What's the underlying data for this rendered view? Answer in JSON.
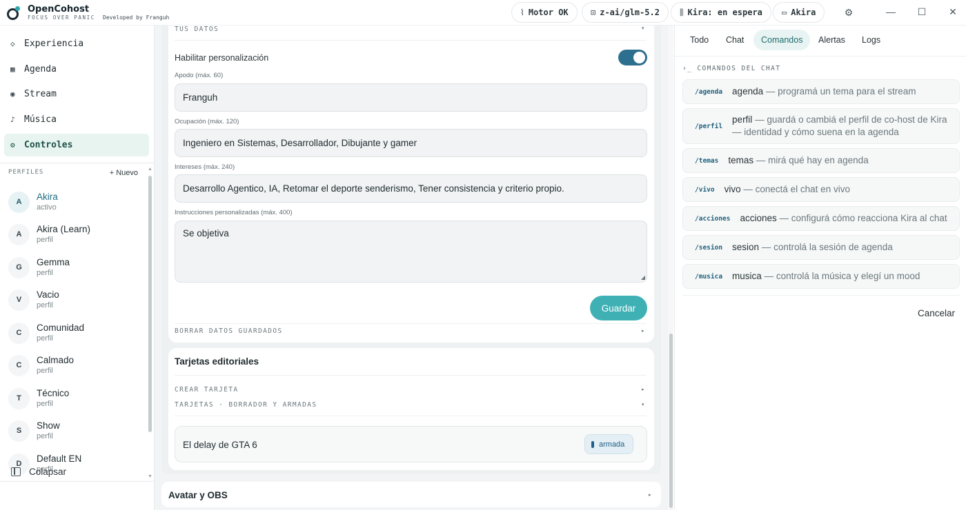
{
  "app": {
    "title": "OpenCohost",
    "tagline": "FOCUS OVER PANIC",
    "developed_by": "Developed by Franguh"
  },
  "topbar": {
    "motor": "Motor OK",
    "model": "z-ai/glm-5.2",
    "kira_status": "Kira: en espera",
    "profile": "Akira"
  },
  "sidebar": {
    "nav": [
      {
        "label": "Experiencia",
        "icon": "diamond-icon"
      },
      {
        "label": "Agenda",
        "icon": "square-icon"
      },
      {
        "label": "Stream",
        "icon": "record-icon"
      },
      {
        "label": "Música",
        "icon": "music-note-icon"
      },
      {
        "label": "Controles",
        "icon": "gear-icon"
      }
    ],
    "profiles_header": "PERFILES",
    "new_label": "+ Nuevo",
    "profiles": [
      {
        "initial": "A",
        "name": "Akira",
        "status": "activo"
      },
      {
        "initial": "A",
        "name": "Akira (Learn)",
        "status": "perfil"
      },
      {
        "initial": "G",
        "name": "Gemma",
        "status": "perfil"
      },
      {
        "initial": "V",
        "name": "Vacio",
        "status": "perfil"
      },
      {
        "initial": "C",
        "name": "Comunidad",
        "status": "perfil"
      },
      {
        "initial": "C",
        "name": "Calmado",
        "status": "perfil"
      },
      {
        "initial": "T",
        "name": "Técnico",
        "status": "perfil"
      },
      {
        "initial": "S",
        "name": "Show",
        "status": "perfil"
      },
      {
        "initial": "D",
        "name": "Default EN",
        "status": "perfil"
      }
    ],
    "collapse_label": "Colapsar"
  },
  "main": {
    "tus_datos": "TUS DATOS",
    "personalize_label": "Habilitar personalización",
    "personalize_enabled": true,
    "apodo_label": "Apodo (máx. 60)",
    "apodo_value": "Franguh",
    "ocupacion_label": "Ocupación (máx. 120)",
    "ocupacion_value": "Ingeniero en Sistemas, Desarrollador, Dibujante y gamer",
    "intereses_label": "Intereses (máx. 240)",
    "intereses_value": "Desarrollo Agentico, IA, Retomar el deporte senderismo, Tener consistencia y criterio propio.",
    "instrucciones_label": "Instrucciones personalizadas (máx. 400)",
    "instrucciones_value": "Se objetiva",
    "save_label": "Guardar",
    "borrar_label": "BORRAR DATOS GUARDADOS",
    "tarjetas_title": "Tarjetas editoriales",
    "crear_label": "CREAR TARJETA",
    "tarjetas_list_label": "TARJETAS · BORRADOR Y ARMADAS",
    "tarjeta_name": "El delay de GTA 6",
    "tarjeta_badge": "armada",
    "avatar_obs_title": "Avatar y OBS"
  },
  "right": {
    "tabs": [
      "Todo",
      "Chat",
      "Comandos",
      "Alertas",
      "Logs"
    ],
    "active_tab": "Comandos",
    "commands_header": "COMANDOS DEL CHAT",
    "commands": [
      {
        "code": "/agenda",
        "name": "agenda",
        "desc": " — programá un tema para el stream"
      },
      {
        "code": "/perfil",
        "name": "perfil",
        "desc": " — guardá o cambiá el perfil de co-host de Kira — identidad y cómo suena en la agenda"
      },
      {
        "code": "/temas",
        "name": "temas",
        "desc": " — mirá qué hay en agenda"
      },
      {
        "code": "/vivo",
        "name": "vivo",
        "desc": " — conectá el chat en vivo"
      },
      {
        "code": "/acciones",
        "name": "acciones",
        "desc": " — configurá cómo reacciona Kira al chat"
      },
      {
        "code": "/sesion",
        "name": "sesion",
        "desc": " — controlá la sesión de agenda"
      },
      {
        "code": "/musica",
        "name": "musica",
        "desc": " — controlá la música y elegí un mood"
      }
    ],
    "cancel_label": "Cancelar"
  },
  "colors": {
    "accent": "#3fb1b5",
    "toggle": "#2d6f8f",
    "active_nav_bg": "#e7f4ef",
    "badge": "#1f5f87"
  }
}
